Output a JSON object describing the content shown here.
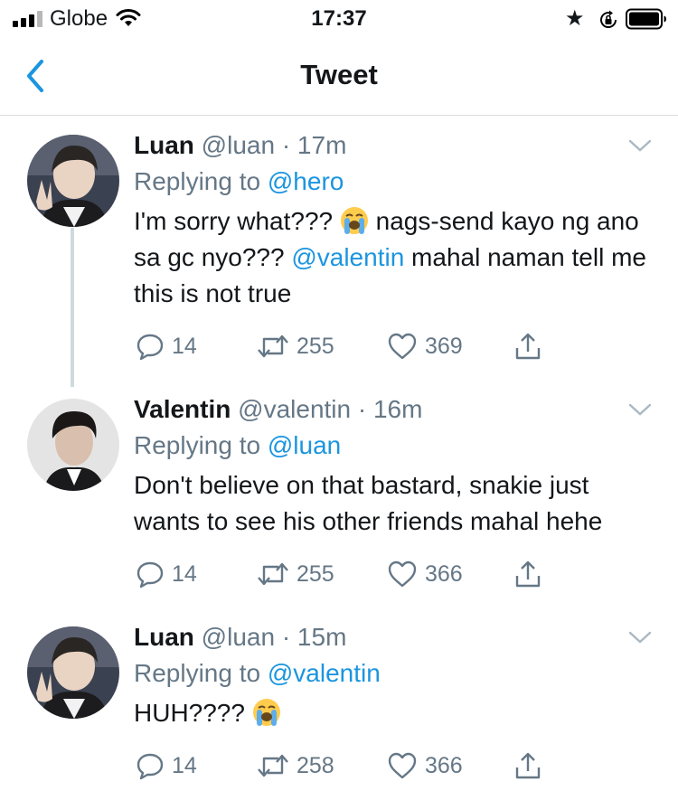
{
  "status_bar": {
    "carrier": "Globe",
    "time": "17:37",
    "signal_bars_filled": 3,
    "signal_bars_total": 4,
    "icons": [
      "signal-icon",
      "wifi-icon",
      "star-icon",
      "rotation-lock-icon",
      "battery-icon"
    ]
  },
  "nav": {
    "title": "Tweet",
    "back_icon": "chevron-left-icon"
  },
  "colors": {
    "link": "#1b95e0",
    "secondary": "#657786",
    "text": "#14171a",
    "thread_line": "#cfd9de"
  },
  "tweets": [
    {
      "name": "Luan",
      "handle": "@luan",
      "time": "· 17m",
      "replying_label": "Replying to",
      "replying_to": "@hero",
      "text_a": "I'm sorry what??? ",
      "text_b": " nags-send kayo ng ano sa gc nyo??? ",
      "mention": "@valentin",
      "text_c": " mahal naman tell me this is not true",
      "emoji": "loudly-crying-face",
      "replies": "14",
      "retweets": "255",
      "likes": "369"
    },
    {
      "name": "Valentin",
      "handle": "@valentin",
      "time": "· 16m",
      "replying_label": "Replying to",
      "replying_to": "@luan",
      "text_a": "Don't believe on that bastard, snakie just wants to see his other friends mahal hehe",
      "replies": "14",
      "retweets": "255",
      "likes": "366"
    },
    {
      "name": "Luan",
      "handle": "@luan",
      "time": "· 15m",
      "replying_label": "Replying to",
      "replying_to": "@valentin",
      "text_a": "HUH???? ",
      "emoji": "loudly-crying-face",
      "replies": "14",
      "retweets": "258",
      "likes": "366"
    }
  ]
}
